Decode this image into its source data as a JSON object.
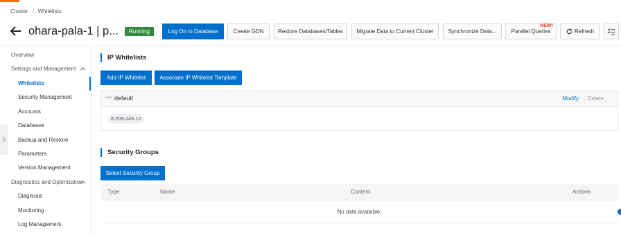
{
  "breadcrumb": [
    "Cluster",
    "Whitelists"
  ],
  "breadcrumb_sep": "/",
  "header": {
    "title": "ohara-pala-1 | p...",
    "status": "Running",
    "buttons": {
      "log_on": "Log On to Database",
      "create_gdn": "Create GDN",
      "restore": "Restore Databases/Tables",
      "migrate": "Migrate Data to Current Cluster",
      "sync": "Synchronize Data...",
      "parallel": "Parallel Queries",
      "new_badge": "NEW!",
      "refresh": "Refresh"
    }
  },
  "sidebar": {
    "overview": "Overview",
    "settings_group": "Settings and Management",
    "items1": [
      "Whitelists",
      "Security Management",
      "Accounts",
      "Databases",
      "Backup and Restore",
      "Parameters",
      "Version Management"
    ],
    "diagnostics_group": "Diagnostics and Optimization",
    "items2": [
      "Diagnosis",
      "Monitoring",
      "Log Management"
    ]
  },
  "ip_whitelists": {
    "title": "IP Whitelists",
    "add_button": "Add IP Whitelist",
    "associate_button": "Associate IP Whitelist Template",
    "group": {
      "name": "default",
      "modify": "Modify",
      "divider": "|",
      "delete": "Delete",
      "ips": [
        "8.209.246.12"
      ]
    }
  },
  "security_groups": {
    "title": "Security Groups",
    "select_button": "Select Security Group",
    "columns": [
      "Type",
      "Name",
      "Content",
      "Actions"
    ],
    "empty": "No data available."
  },
  "colors": {
    "primary": "#0070cc",
    "status_green": "#2e8b3a",
    "accent_orange": "#ff6a00",
    "new_red": "#e63b2e"
  }
}
